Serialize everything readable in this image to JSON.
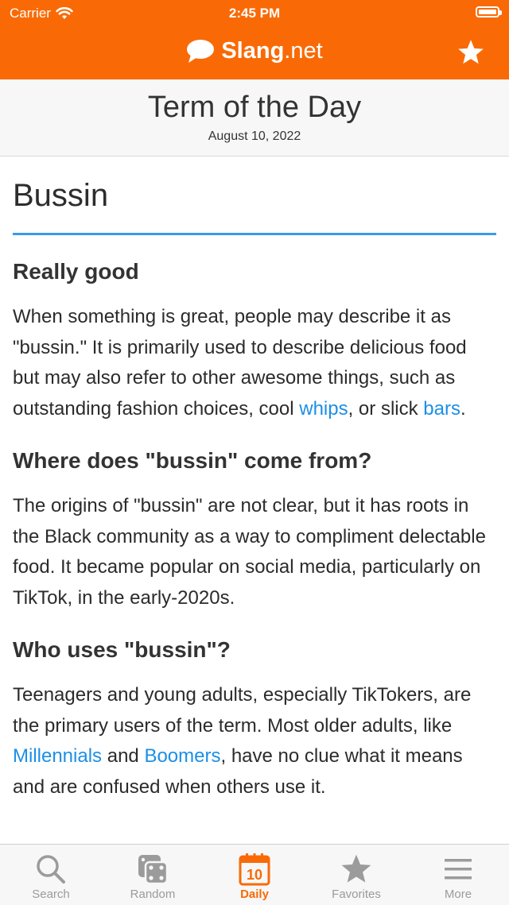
{
  "status": {
    "carrier": "Carrier",
    "time": "2:45 PM"
  },
  "nav": {
    "brand_bold": "Slang",
    "brand_suffix": ".net",
    "favorite_icon": "star-icon"
  },
  "banner": {
    "title": "Term of the Day",
    "date": "August 10, 2022"
  },
  "term": "Bussin",
  "sections": {
    "s1_heading": "Really good",
    "s1_p1": "When something is great, people may describe it as \"bussin.\" It is primarily used to describe delicious food but may also refer to other awesome things, such as outstanding fashion choices, cool ",
    "s1_link1": "whips",
    "s1_p2": ", or slick ",
    "s1_link2": "bars",
    "s1_p3": ".",
    "s2_heading": "Where does \"bussin\" come from?",
    "s2_p": "The origins of \"bussin\" are not clear, but it has roots in the Black community as a way to compliment delectable food. It became popular on social media, particularly on TikTok, in the early-2020s.",
    "s3_heading": "Who uses \"bussin\"?",
    "s3_p1": "Teenagers and young adults, especially TikTokers, are the primary users of the term. Most older adults, like ",
    "s3_link1": "Millennials",
    "s3_p2": " and ",
    "s3_link2": "Boomers",
    "s3_p3": ", have no clue what it means and are confused when others use it."
  },
  "tabs": {
    "search": "Search",
    "random": "Random",
    "daily": "Daily",
    "daily_day": "10",
    "favorites": "Favorites",
    "more": "More"
  },
  "colors": {
    "accent": "#f96a06",
    "link": "#1c8fe6",
    "rule": "#3a9be8",
    "inactive": "#9b9b9b"
  }
}
